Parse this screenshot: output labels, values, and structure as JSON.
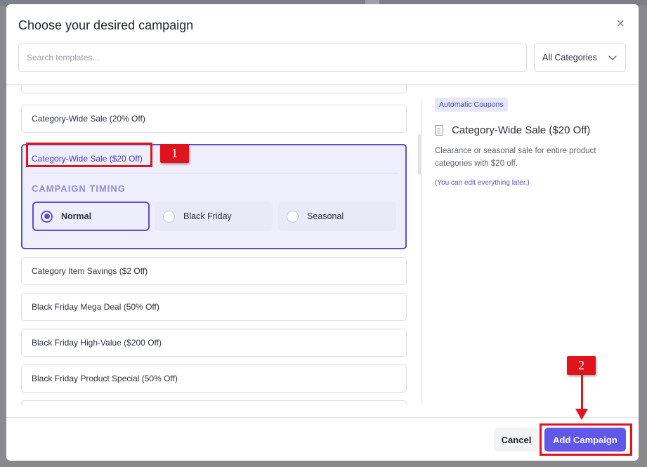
{
  "modal": {
    "title": "Choose your desired campaign",
    "close_glyph": "×"
  },
  "search": {
    "placeholder": "Search templates...",
    "value": ""
  },
  "category_filter": {
    "selected": "All Categories",
    "icon": "chevron-down-icon"
  },
  "templates": {
    "items": [
      {
        "label": ""
      },
      {
        "label": "Category-Wide Sale (20% Off)"
      },
      {
        "label": "Category-Wide Sale ($20 Off)",
        "expanded": true
      },
      {
        "label": "Category Item Savings ($2 Off)"
      },
      {
        "label": "Black Friday Mega Deal (50% Off)"
      },
      {
        "label": "Black Friday High-Value ($200 Off)"
      },
      {
        "label": "Black Friday Product Special (50% Off)"
      },
      {
        "label": ""
      }
    ],
    "timing": {
      "label": "CAMPAIGN TIMING",
      "options": [
        {
          "label": "Normal",
          "selected": true
        },
        {
          "label": "Black Friday",
          "selected": false
        },
        {
          "label": "Seasonal",
          "selected": false
        }
      ]
    }
  },
  "preview": {
    "badge": "Automatic Coupons",
    "title": "Category-Wide Sale ($20 Off)",
    "icon": "document-icon",
    "description": "Clearance or seasonal sale for entire product categories with $20 off.",
    "note": "(You can edit everything later.)"
  },
  "footer": {
    "cancel_label": "Cancel",
    "add_label": "Add Campaign"
  },
  "annotations": {
    "step1": "1",
    "step2": "2",
    "color": "#e0141c"
  },
  "colors": {
    "accent": "#5b50c9",
    "primary_button": "#6158e8",
    "selected_bg": "#efeefc"
  }
}
